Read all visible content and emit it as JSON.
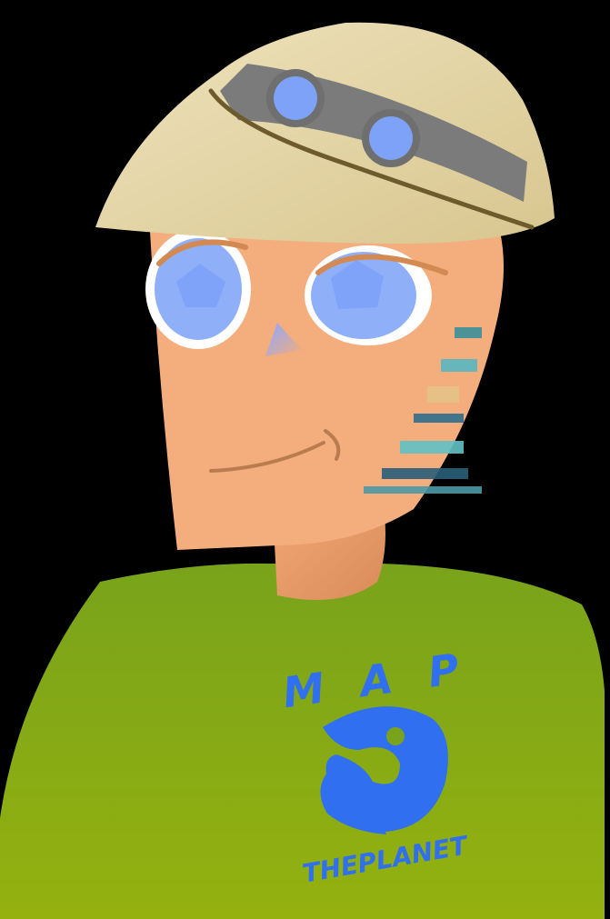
{
  "shirt": {
    "logo_word_top": "MAP",
    "logo_word_bottom": "THEPLANET",
    "logo_color": "#2f6ff0",
    "shirt_color_top": "#7aa41a",
    "shirt_color_bottom": "#8fb012"
  },
  "colors": {
    "background": "#000000",
    "skin": "#f4ad7c",
    "hat": "#e6d6a8",
    "hat_band": "#7b7b7b",
    "goggle_lens": "#7da2f7",
    "eye_iris": "#8fb0f8",
    "mouth": "#b97c4f"
  },
  "icons": {
    "hat": "pith-helmet-icon",
    "goggles": "goggles-icon",
    "logo_hand": "globe-hand-icon"
  }
}
